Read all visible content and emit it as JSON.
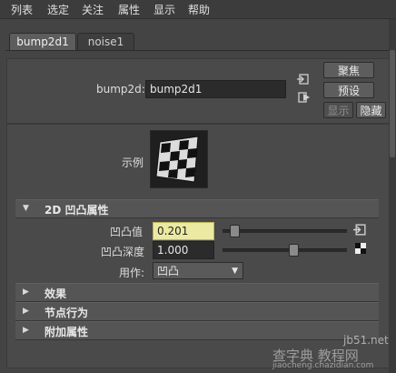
{
  "menu": [
    "列表",
    "选定",
    "关注",
    "属性",
    "显示",
    "帮助"
  ],
  "tabs": [
    {
      "label": "bump2d1",
      "active": true
    },
    {
      "label": "noise1",
      "active": false
    }
  ],
  "node": {
    "label": "bump2d:",
    "value": "bump2d1",
    "buttons": {
      "focus": "聚焦",
      "presets": "预设",
      "show": "显示",
      "hide": "隐藏"
    }
  },
  "sample": {
    "label": "示例"
  },
  "sections": {
    "bump_attrs": {
      "title": "2D 凹凸属性",
      "expanded": true,
      "bump_value": {
        "label": "凹凸值",
        "value": "0.201"
      },
      "bump_depth": {
        "label": "凹凸深度",
        "value": "1.000"
      },
      "use_as": {
        "label": "用作:",
        "value": "凹凸"
      }
    },
    "effects": {
      "title": "效果"
    },
    "node_behavior": {
      "title": "节点行为"
    },
    "extra_attrs": {
      "title": "附加属性"
    }
  },
  "watermark": {
    "site": "jb51.net",
    "text": "查字典 教程网",
    "url": "jiaocheng.chazidian.com"
  },
  "colors": {
    "highlight_field": "#ece9a2",
    "panel": "#444444"
  }
}
